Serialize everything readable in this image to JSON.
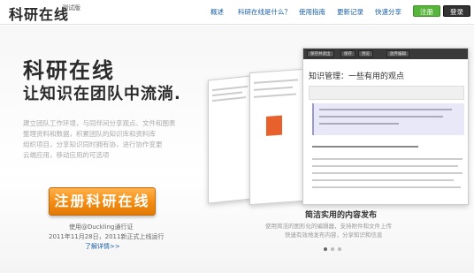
{
  "header": {
    "logo": "科研在线",
    "logo_tag": "测试版",
    "nav": [
      "概述",
      "科研在线是什么？",
      "使用指南",
      "更新记录",
      "快速分享"
    ],
    "signup": "注册",
    "login": "登录"
  },
  "hero": {
    "title1": "科研在线",
    "title2": "让知识在团队中流淌.",
    "desc": [
      "建立团队工作环境，与同伴间分享观点、文件和图表",
      "整理资料和数据，积累团队的知识库和资料库",
      "组织项目，分享知识同时拥有协，进行协作变更",
      "云端应用，移动应用的可选项"
    ],
    "cta": "注册科研在线",
    "note1": "使用@Duckling通行证",
    "note2": "2011年11月28日，2011新正式上线运行",
    "note3": "了解详情>>"
  },
  "showcase": {
    "toolbar": [
      "保存并退出",
      "保存",
      "预览",
      "放弃编辑"
    ],
    "doc_title": "知识管理：一些有用的观点",
    "feature_title": "简洁实用的内容发布",
    "feature_desc": [
      "使用简洁的图形化的编辑器，支持附件和文件上传",
      "快速有效地发布内容，分享知识和信息"
    ]
  }
}
